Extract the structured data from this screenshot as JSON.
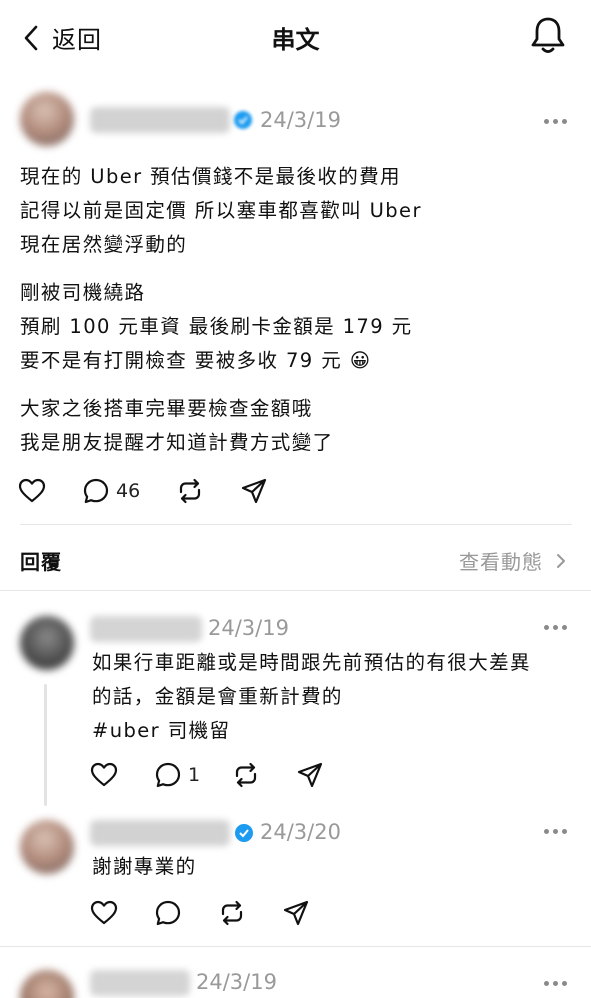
{
  "header": {
    "back_label": "返回",
    "title": "串文"
  },
  "post": {
    "username": "jianlongzhong",
    "date": "24/3/19",
    "paragraphs": [
      [
        "現在的 Uber 預估價錢不是最後收的費用",
        "記得以前是固定價 所以塞車都喜歡叫 Uber",
        "現在居然變浮動的"
      ],
      [
        "剛被司機繞路",
        "預刷 100 元車資  最後刷卡金額是 179 元",
        "要不是有打開檢查 要被多收 79 元 😀"
      ],
      [
        "大家之後搭車完畢要檢查金額哦",
        "我是朋友提醒才知道計費方式變了"
      ]
    ],
    "reply_count": "46"
  },
  "replies_section": {
    "title": "回覆",
    "view_activity": "查看動態"
  },
  "replies": [
    {
      "username": "liuliuhome",
      "date": "24/3/19",
      "lines": [
        "如果行車距離或是時間跟先前預估的有很大差異",
        "的話，金額是會重新計費的",
        "#uber 司機留"
      ],
      "reply_count": "1"
    },
    {
      "username": "jianlongzhong",
      "date": "24/3/20",
      "lines": [
        "謝謝專業的"
      ],
      "reply_count": ""
    },
    {
      "username": "kaiwei715",
      "date": "24/3/19"
    }
  ],
  "colors": {
    "text": "#111111",
    "muted": "#999999",
    "verified": "#1d9bf0",
    "divider": "#e6e6e6"
  }
}
